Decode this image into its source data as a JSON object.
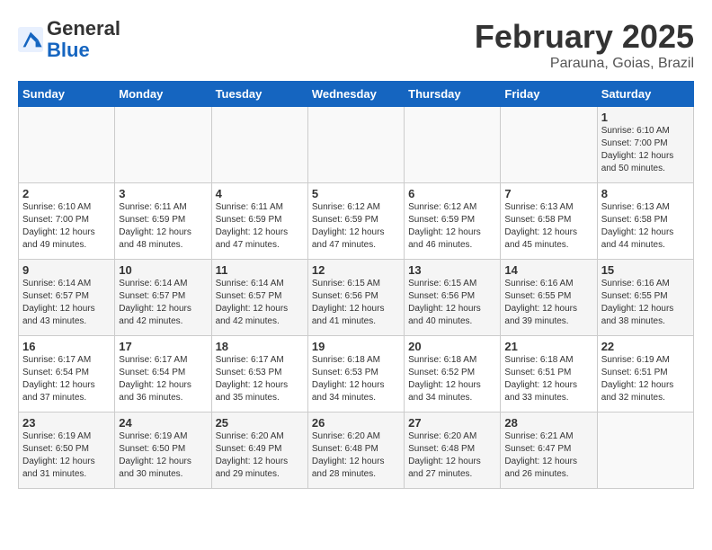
{
  "header": {
    "logo_general": "General",
    "logo_blue": "Blue",
    "title": "February 2025",
    "subtitle": "Parauna, Goias, Brazil"
  },
  "weekdays": [
    "Sunday",
    "Monday",
    "Tuesday",
    "Wednesday",
    "Thursday",
    "Friday",
    "Saturday"
  ],
  "weeks": [
    [
      {
        "day": "",
        "info": ""
      },
      {
        "day": "",
        "info": ""
      },
      {
        "day": "",
        "info": ""
      },
      {
        "day": "",
        "info": ""
      },
      {
        "day": "",
        "info": ""
      },
      {
        "day": "",
        "info": ""
      },
      {
        "day": "1",
        "info": "Sunrise: 6:10 AM\nSunset: 7:00 PM\nDaylight: 12 hours\nand 50 minutes."
      }
    ],
    [
      {
        "day": "2",
        "info": "Sunrise: 6:10 AM\nSunset: 7:00 PM\nDaylight: 12 hours\nand 49 minutes."
      },
      {
        "day": "3",
        "info": "Sunrise: 6:11 AM\nSunset: 6:59 PM\nDaylight: 12 hours\nand 48 minutes."
      },
      {
        "day": "4",
        "info": "Sunrise: 6:11 AM\nSunset: 6:59 PM\nDaylight: 12 hours\nand 47 minutes."
      },
      {
        "day": "5",
        "info": "Sunrise: 6:12 AM\nSunset: 6:59 PM\nDaylight: 12 hours\nand 47 minutes."
      },
      {
        "day": "6",
        "info": "Sunrise: 6:12 AM\nSunset: 6:59 PM\nDaylight: 12 hours\nand 46 minutes."
      },
      {
        "day": "7",
        "info": "Sunrise: 6:13 AM\nSunset: 6:58 PM\nDaylight: 12 hours\nand 45 minutes."
      },
      {
        "day": "8",
        "info": "Sunrise: 6:13 AM\nSunset: 6:58 PM\nDaylight: 12 hours\nand 44 minutes."
      }
    ],
    [
      {
        "day": "9",
        "info": "Sunrise: 6:14 AM\nSunset: 6:57 PM\nDaylight: 12 hours\nand 43 minutes."
      },
      {
        "day": "10",
        "info": "Sunrise: 6:14 AM\nSunset: 6:57 PM\nDaylight: 12 hours\nand 42 minutes."
      },
      {
        "day": "11",
        "info": "Sunrise: 6:14 AM\nSunset: 6:57 PM\nDaylight: 12 hours\nand 42 minutes."
      },
      {
        "day": "12",
        "info": "Sunrise: 6:15 AM\nSunset: 6:56 PM\nDaylight: 12 hours\nand 41 minutes."
      },
      {
        "day": "13",
        "info": "Sunrise: 6:15 AM\nSunset: 6:56 PM\nDaylight: 12 hours\nand 40 minutes."
      },
      {
        "day": "14",
        "info": "Sunrise: 6:16 AM\nSunset: 6:55 PM\nDaylight: 12 hours\nand 39 minutes."
      },
      {
        "day": "15",
        "info": "Sunrise: 6:16 AM\nSunset: 6:55 PM\nDaylight: 12 hours\nand 38 minutes."
      }
    ],
    [
      {
        "day": "16",
        "info": "Sunrise: 6:17 AM\nSunset: 6:54 PM\nDaylight: 12 hours\nand 37 minutes."
      },
      {
        "day": "17",
        "info": "Sunrise: 6:17 AM\nSunset: 6:54 PM\nDaylight: 12 hours\nand 36 minutes."
      },
      {
        "day": "18",
        "info": "Sunrise: 6:17 AM\nSunset: 6:53 PM\nDaylight: 12 hours\nand 35 minutes."
      },
      {
        "day": "19",
        "info": "Sunrise: 6:18 AM\nSunset: 6:53 PM\nDaylight: 12 hours\nand 34 minutes."
      },
      {
        "day": "20",
        "info": "Sunrise: 6:18 AM\nSunset: 6:52 PM\nDaylight: 12 hours\nand 34 minutes."
      },
      {
        "day": "21",
        "info": "Sunrise: 6:18 AM\nSunset: 6:51 PM\nDaylight: 12 hours\nand 33 minutes."
      },
      {
        "day": "22",
        "info": "Sunrise: 6:19 AM\nSunset: 6:51 PM\nDaylight: 12 hours\nand 32 minutes."
      }
    ],
    [
      {
        "day": "23",
        "info": "Sunrise: 6:19 AM\nSunset: 6:50 PM\nDaylight: 12 hours\nand 31 minutes."
      },
      {
        "day": "24",
        "info": "Sunrise: 6:19 AM\nSunset: 6:50 PM\nDaylight: 12 hours\nand 30 minutes."
      },
      {
        "day": "25",
        "info": "Sunrise: 6:20 AM\nSunset: 6:49 PM\nDaylight: 12 hours\nand 29 minutes."
      },
      {
        "day": "26",
        "info": "Sunrise: 6:20 AM\nSunset: 6:48 PM\nDaylight: 12 hours\nand 28 minutes."
      },
      {
        "day": "27",
        "info": "Sunrise: 6:20 AM\nSunset: 6:48 PM\nDaylight: 12 hours\nand 27 minutes."
      },
      {
        "day": "28",
        "info": "Sunrise: 6:21 AM\nSunset: 6:47 PM\nDaylight: 12 hours\nand 26 minutes."
      },
      {
        "day": "",
        "info": ""
      }
    ]
  ]
}
